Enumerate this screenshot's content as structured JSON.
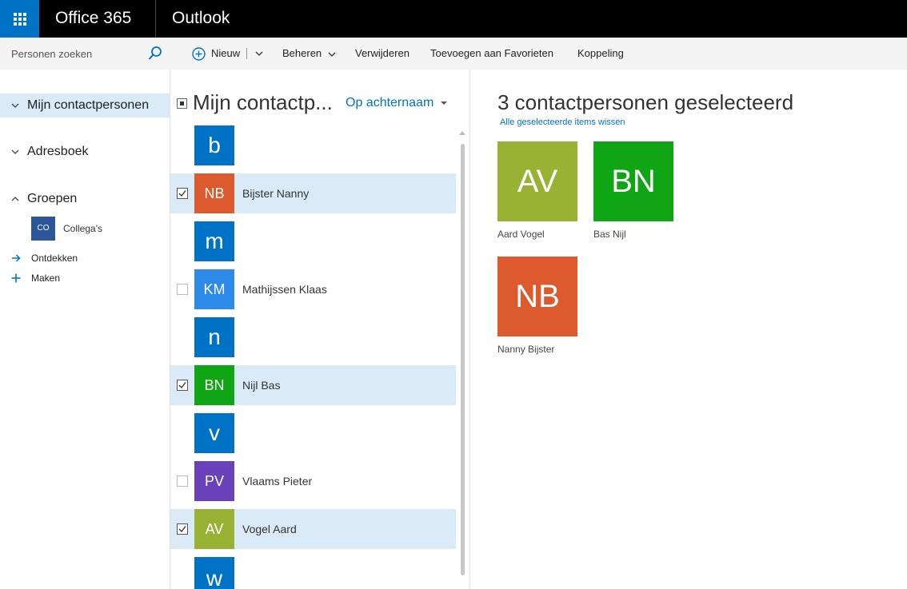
{
  "topbar": {
    "brand": "Office 365",
    "app": "Outlook"
  },
  "search": {
    "placeholder": "Personen zoeken"
  },
  "commands": {
    "new": "Nieuw",
    "manage": "Beheren",
    "delete": "Verwijderen",
    "add_favorites": "Toevoegen aan Favorieten",
    "link": "Koppeling"
  },
  "nav": {
    "my_contacts": "Mijn contactpersonen",
    "address_book": "Adresboek",
    "groups": "Groepen",
    "group_items": [
      {
        "initials": "CO",
        "label": "Collega's"
      }
    ],
    "discover": "Ontdekken",
    "create": "Maken"
  },
  "list": {
    "title": "Mijn contactp...",
    "sort_label": "Op achternaam",
    "letters": [
      "b",
      "m",
      "n",
      "v",
      "w"
    ],
    "contacts": [
      {
        "initials": "NB",
        "name": "Bijster Nanny",
        "checked": true,
        "color": "#dc5a2e"
      },
      {
        "initials": "KM",
        "name": "Mathijssen Klaas",
        "checked": false,
        "color": "#2d8ae8"
      },
      {
        "initials": "BN",
        "name": "Nijl Bas",
        "checked": true,
        "color": "#10a515"
      },
      {
        "initials": "PV",
        "name": "Vlaams Pieter",
        "checked": false,
        "color": "#6941bb"
      },
      {
        "initials": "AV",
        "name": "Vogel Aard",
        "checked": true,
        "color": "#98b233"
      }
    ]
  },
  "selection": {
    "title": "3 contactpersonen geselecteerd",
    "clear_all": "Alle geselecteerde items wissen",
    "cards": [
      {
        "initials": "AV",
        "name": "Aard Vogel",
        "color": "#98b233"
      },
      {
        "initials": "BN",
        "name": "Bas Nijl",
        "color": "#10a515"
      },
      {
        "initials": "NB",
        "name": "Nanny Bijster",
        "color": "#dc5a2e"
      }
    ]
  },
  "colors": {
    "accent": "#0072c6",
    "letter_tile": "#0072c6",
    "selected_row": "#daeaf7",
    "topbar": "#000000"
  },
  "icons": [
    "app-launcher-icon",
    "search-icon",
    "plus-circle-icon",
    "chevron-down-icon",
    "chevron-up-icon",
    "arrow-right-icon",
    "plus-icon",
    "checkmark-icon"
  ]
}
